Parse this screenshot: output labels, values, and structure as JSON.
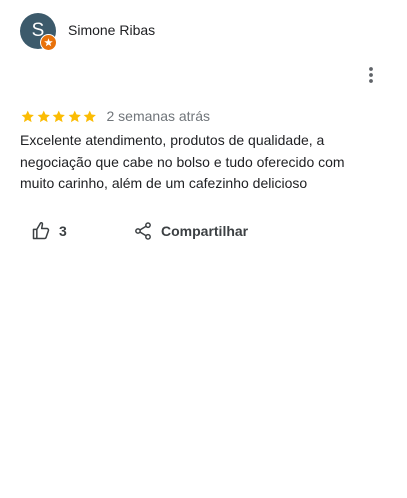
{
  "review": {
    "reviewer": {
      "initial": "S",
      "name": "Simone Ribas",
      "avatar_color": "#3c5a6b",
      "badge_icon": "local-guide-badge-icon",
      "badge_color": "#e8710a"
    },
    "rating": {
      "value": 5,
      "max": 5,
      "star_color": "#fbbc04"
    },
    "date": "2 semanas atrás",
    "text": "Excelente atendimento, produtos de qualidade, a negociação que cabe no bolso e tudo oferecido com muito carinho, além de um cafezinho delicioso",
    "actions": {
      "like_icon": "thumbs-up-icon",
      "like_count": "3",
      "share_icon": "share-icon",
      "share_label": "Compartilhar",
      "more_icon": "more-vert-icon"
    }
  }
}
